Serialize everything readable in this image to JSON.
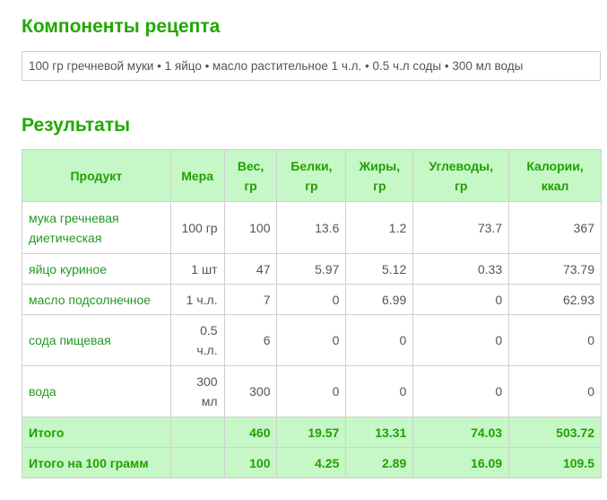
{
  "headings": {
    "ingredients": "Компоненты рецепта",
    "results": "Результаты"
  },
  "ingredients_text": "100 гр гречневой муки • 1 яйцо • масло растительное 1 ч.л. • 0.5 ч.л соды • 300 мл воды",
  "table": {
    "columns": {
      "product": "Продукт",
      "measure": "Мера",
      "weight_1": "Вес,",
      "weight_2": "гр",
      "protein_1": "Белки,",
      "protein_2": "гр",
      "fat_1": "Жиры,",
      "fat_2": "гр",
      "carbs_1": "Углеводы,",
      "carbs_2": "гр",
      "calories_1": "Калории,",
      "calories_2": "ккал"
    },
    "rows": [
      {
        "name_1": "мука гречневая",
        "name_2": "диетическая",
        "measure_1": "100 гр",
        "measure_2": "",
        "weight": "100",
        "protein": "13.6",
        "fat": "1.2",
        "carbs": "73.7",
        "calories": "367"
      },
      {
        "name_1": "яйцо куриное",
        "name_2": "",
        "measure_1": "1 шт",
        "measure_2": "",
        "weight": "47",
        "protein": "5.97",
        "fat": "5.12",
        "carbs": "0.33",
        "calories": "73.79"
      },
      {
        "name_1": "масло подсолнечное",
        "name_2": "",
        "measure_1": "1 ч.л.",
        "measure_2": "",
        "weight": "7",
        "protein": "0",
        "fat": "6.99",
        "carbs": "0",
        "calories": "62.93"
      },
      {
        "name_1": "сода пищевая",
        "name_2": "",
        "measure_1": "0.5",
        "measure_2": "ч.л.",
        "weight": "6",
        "protein": "0",
        "fat": "0",
        "carbs": "0",
        "calories": "0"
      },
      {
        "name_1": "вода",
        "name_2": "",
        "measure_1": "300",
        "measure_2": "мл",
        "weight": "300",
        "protein": "0",
        "fat": "0",
        "carbs": "0",
        "calories": "0"
      }
    ],
    "totals": [
      {
        "label": "Итого",
        "weight": "460",
        "protein": "19.57",
        "fat": "13.31",
        "carbs": "74.03",
        "calories": "503.72"
      },
      {
        "label": "Итого на 100 грамм",
        "weight": "100",
        "protein": "4.25",
        "fat": "2.89",
        "carbs": "16.09",
        "calories": "109.5"
      }
    ]
  },
  "colors": {
    "heading_green": "#20a800",
    "header_bg": "#c6f7c6",
    "link_green": "#229922"
  }
}
